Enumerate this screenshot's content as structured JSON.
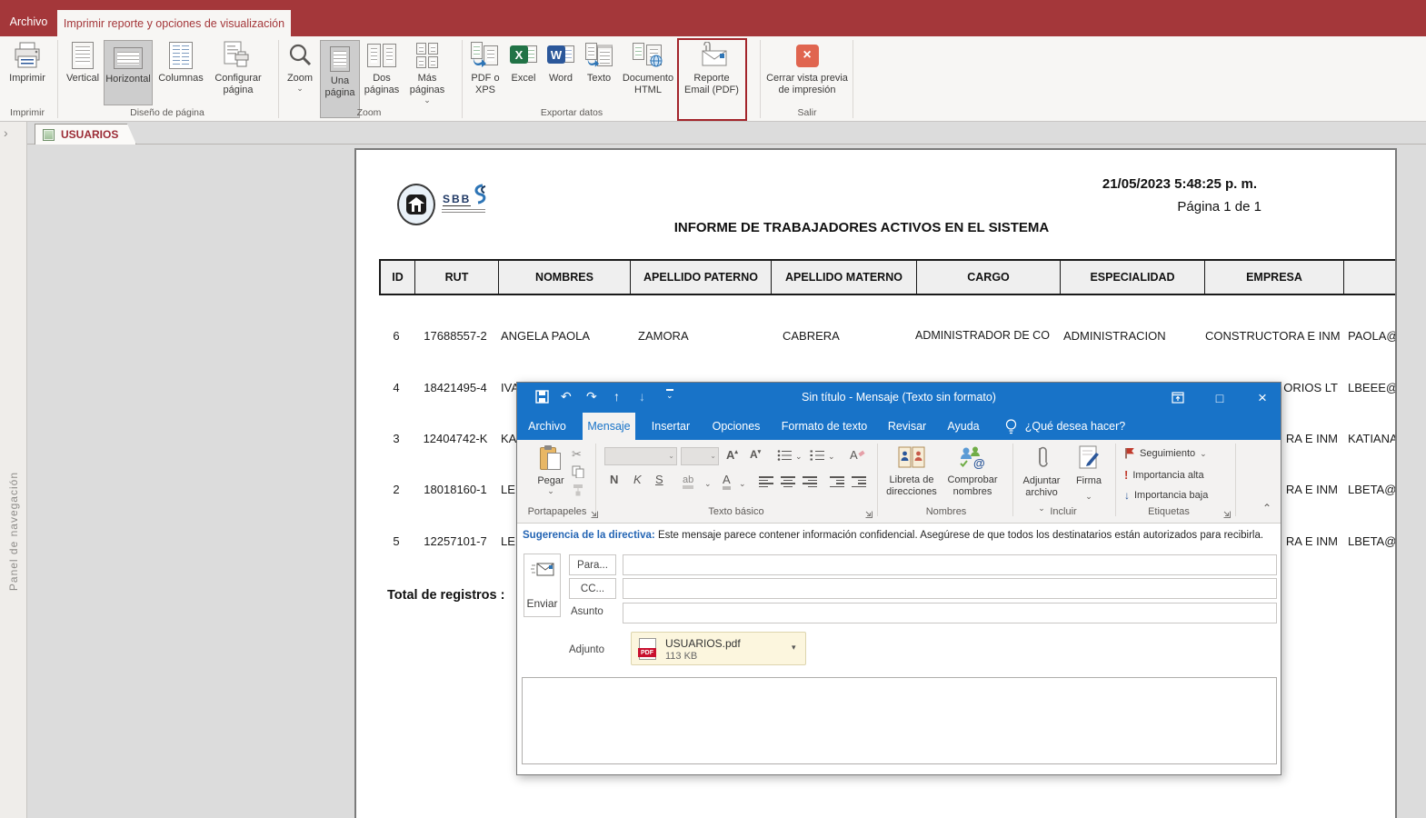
{
  "colors": {
    "access_accent": "#A4373A",
    "outlook_titlebar": "#1873C8",
    "excel_green": "#217346",
    "word_blue": "#2B579A",
    "pdf_red": "#C8102E",
    "close_button_orange": "#E0654F",
    "flag_red": "#C0392B",
    "importance_low_blue": "#2B579A",
    "attachment_bg": "#FCF6DE",
    "annotation_box_red": "#A3242A"
  },
  "icons": {
    "chevron_down": "⌄",
    "dropdown_small": "▾",
    "up_small": "▴",
    "undo": "↶",
    "redo": "↷",
    "arrow_up": "↑",
    "arrow_down": "↓",
    "close": "×",
    "maximize": "□",
    "collapse_ribbon": "⌃",
    "nav_expand": "›",
    "scissors": "✂",
    "letter_a": "A",
    "exclaim": "!",
    "excel_letter": "X",
    "word_letter": "W"
  },
  "access": {
    "file_tab": "Archivo",
    "active_tab": "Imprimir reporte y opciones de visualización",
    "ribbon": {
      "imprimir": "Imprimir",
      "group_imprimir": "Imprimir",
      "vertical": "Vertical",
      "horizontal": "Horizontal",
      "columnas": "Columnas",
      "configurar_pagina": "Configurar página",
      "group_diseno": "Diseño de página",
      "zoom": "Zoom",
      "una_pagina": "Una página",
      "dos_paginas": "Dos páginas",
      "mas_paginas": "Más páginas",
      "group_zoom": "Zoom",
      "pdf_xps": "PDF o XPS",
      "excel": "Excel",
      "word": "Word",
      "texto": "Texto",
      "documento_html": "Documento HTML",
      "group_exportar": "Exportar datos",
      "reporte_email": "Reporte Email (PDF)",
      "cerrar_vista": "Cerrar vista previa de impresión",
      "group_salir": "Salir"
    },
    "nav_panel_label": "Panel de navegación",
    "object_tab": "USUARIOS"
  },
  "report": {
    "datetime": "21/05/2023 5:48:25 p. m.",
    "page_info": "Página 1 de 1",
    "logo_text": "SBB",
    "title": "INFORME DE TRABAJADORES ACTIVOS EN EL SISTEMA",
    "columns": [
      "ID",
      "RUT",
      "NOMBRES",
      "APELLIDO PATERNO",
      "APELLIDO MATERNO",
      "CARGO",
      "ESPECIALIDAD",
      "EMPRESA"
    ],
    "rows": [
      {
        "id": "6",
        "rut": "17688557-2",
        "nombres": "ANGELA PAOLA",
        "apellido_paterno": "ZAMORA",
        "apellido_materno": "CABRERA",
        "cargo": "ADMINISTRADOR DE CO",
        "especialidad": "ADMINISTRACION",
        "empresa": "CONSTRUCTORA E INM",
        "email": "PAOLA@"
      },
      {
        "id": "4",
        "rut": "18421495-4",
        "nombres": "IVA",
        "empresa": "ORIOS LT",
        "email": "LBEEE@C"
      },
      {
        "id": "3",
        "rut": "12404742-K",
        "nombres": "KA",
        "empresa": "RA E INM",
        "email": "KATIANA"
      },
      {
        "id": "2",
        "rut": "18018160-1",
        "nombres": "LE",
        "empresa": "RA E INM",
        "email": "LBETA@C"
      },
      {
        "id": "5",
        "rut": "12257101-7",
        "nombres": "LE",
        "empresa": "RA E INM",
        "email": "LBETA@C"
      }
    ],
    "total_label": "Total de registros :"
  },
  "outlook": {
    "window_title": "Sin título  -  Mensaje (Texto sin formato)",
    "tabs": [
      "Archivo",
      "Mensaje",
      "Insertar",
      "Opciones",
      "Formato de texto",
      "Revisar",
      "Ayuda"
    ],
    "tell_me": "¿Qué desea hacer?",
    "ribbon": {
      "pegar": "Pegar",
      "group_portapapeles": "Portapapeles",
      "bold": "N",
      "italic": "K",
      "underline": "S",
      "group_texto_basico": "Texto básico",
      "libreta": "Libreta de direcciones",
      "comprobar": "Comprobar nombres",
      "group_nombres": "Nombres",
      "adjuntar": "Adjuntar archivo",
      "firma": "Firma",
      "group_incluir": "Incluir",
      "seguimiento": "Seguimiento",
      "importancia_alta": "Importancia alta",
      "importancia_baja": "Importancia baja",
      "group_etiquetas": "Etiquetas"
    },
    "policy_label": "Sugerencia de la directiva:",
    "policy_text": "Este mensaje parece contener información confidencial. Asegúrese de que todos los destinatarios están autorizados para recibirla.",
    "enviar": "Enviar",
    "para": "Para...",
    "cc": "CC...",
    "asunto": "Asunto",
    "adjunto": "Adjunto",
    "attachment": {
      "name": "USUARIOS.pdf",
      "size": "113 KB",
      "badge": "PDF"
    }
  }
}
